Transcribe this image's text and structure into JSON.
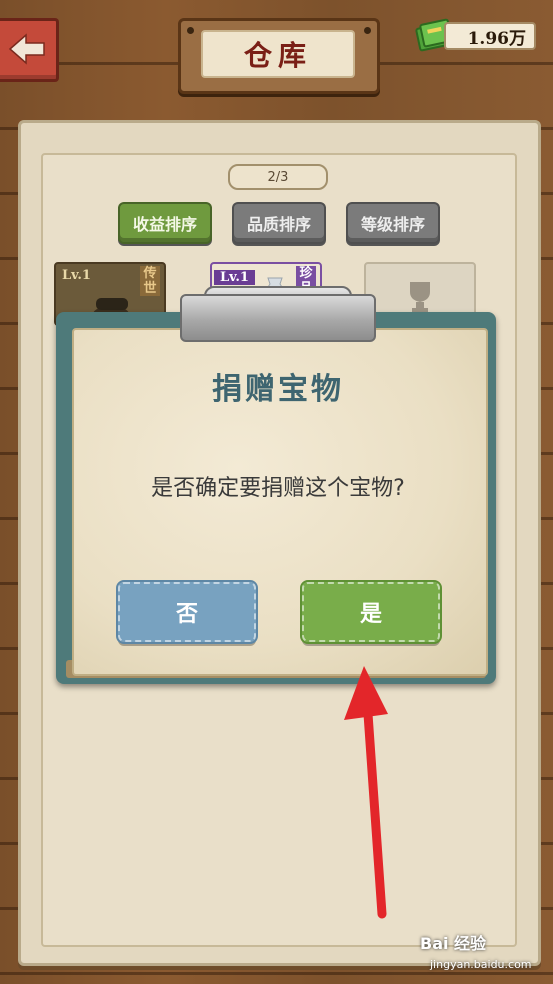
{
  "header": {
    "title": "仓库",
    "money": "1.96万"
  },
  "warehouse": {
    "page_indicator": "2/3",
    "sort_buttons": [
      {
        "label": "收益排序",
        "active": true
      },
      {
        "label": "品质排序",
        "active": false
      },
      {
        "label": "等级排序",
        "active": false
      }
    ],
    "items": [
      {
        "level": "Lv.1",
        "tag": "传世"
      },
      {
        "level": "Lv.1",
        "tag": "珍品"
      },
      {
        "level": "",
        "tag": ""
      }
    ]
  },
  "dialog": {
    "title": "捐赠宝物",
    "message": "是否确定要捐赠这个宝物?",
    "no_label": "否",
    "yes_label": "是"
  },
  "watermark": {
    "brand": "Bai 经验",
    "url": "jingyan.baidu.com"
  },
  "colors": {
    "accent_green": "#79ad4a",
    "accent_blue": "#78a2c0",
    "title_red": "#7a1f16",
    "annotation_arrow": "#e3262a"
  }
}
